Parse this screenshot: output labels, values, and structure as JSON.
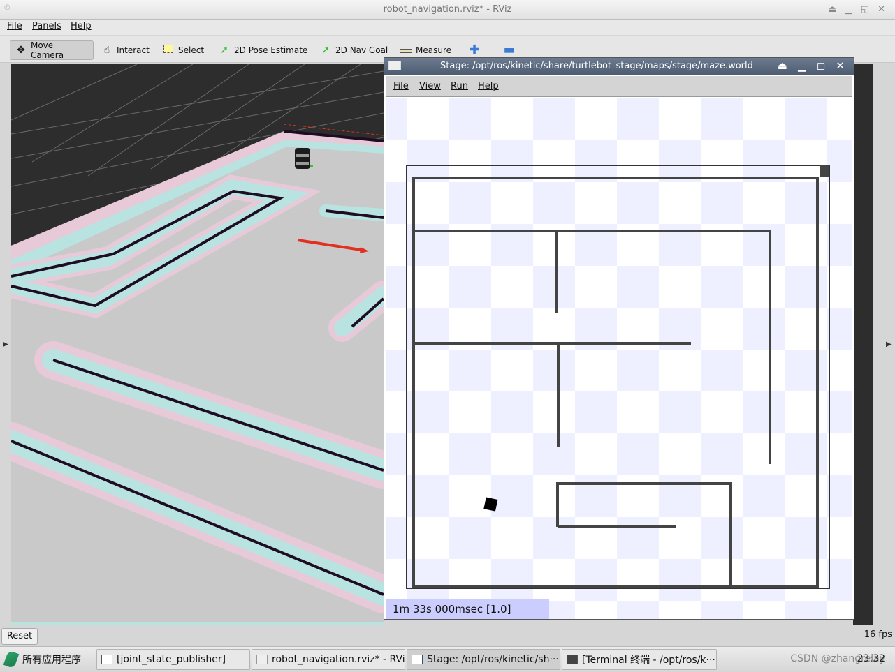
{
  "window": {
    "title": "robot_navigation.rviz* - RViz",
    "controls": "⏏ ▁ ◱ ✕"
  },
  "menu": [
    "File",
    "Panels",
    "Help"
  ],
  "toolbar": {
    "tools": [
      {
        "label": "Move Camera",
        "icon": "move-camera-icon",
        "active": true
      },
      {
        "label": "Interact",
        "icon": "hand-icon"
      },
      {
        "label": "Select",
        "icon": "select-box-icon"
      },
      {
        "label": "2D Pose Estimate",
        "icon": "green-arrow-icon"
      },
      {
        "label": "2D Nav Goal",
        "icon": "green-arrow-icon"
      },
      {
        "label": "Measure",
        "icon": "ruler-icon"
      }
    ],
    "add_icon": "plus-icon",
    "remove_icon": "minus-icon"
  },
  "status": {
    "reset_label": "Reset",
    "fps": "16 fps"
  },
  "stage": {
    "title": "Stage: /opt/ros/kinetic/share/turtlebot_stage/maps/stage/maze.world",
    "menu": [
      "File",
      "View",
      "Run",
      "Help"
    ],
    "clock": "1m 33s 000msec [1.0]"
  },
  "taskbar": {
    "apps_label": "所有应用程序",
    "tasks": [
      "[joint_state_publisher]",
      "robot_navigation.rviz* - RViz",
      "Stage: /opt/ros/kinetic/sh···",
      "[Terminal 终端 - /opt/ros/k···"
    ],
    "clock": "23:32",
    "watermark": "CSDN @zhangrelay"
  },
  "colors": {
    "stage_title": "#5a687e",
    "stage_clock_bg": "#cccdff",
    "checker": "#eff0ff",
    "wall": "#444444",
    "viewport_bg": "#2d2d2d"
  }
}
